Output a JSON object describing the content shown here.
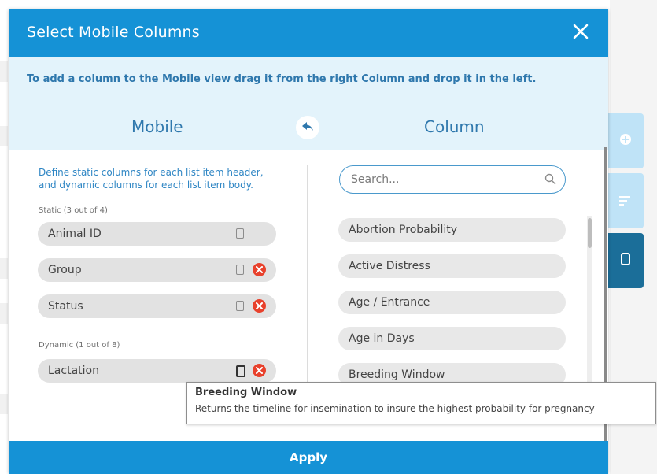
{
  "modal": {
    "title": "Select Mobile Columns",
    "instruction": "To add a column to the Mobile view drag it from the right Column and drop it in the left.",
    "mobile_heading": "Mobile",
    "column_heading": "Column",
    "apply_label": "Apply"
  },
  "mobile_panel": {
    "hint": "Define static columns for each list item header, and dynamic columns for each list item body.",
    "static_label": "Static (3 out of 4)",
    "static_items": [
      {
        "label": "Animal ID",
        "removable": false
      },
      {
        "label": "Group",
        "removable": true
      },
      {
        "label": "Status",
        "removable": true
      }
    ],
    "dynamic_label": "Dynamic (1 out of 8)",
    "dynamic_items": [
      {
        "label": "Lactation",
        "removable": true
      }
    ]
  },
  "column_panel": {
    "search_placeholder": "Search...",
    "items": [
      {
        "label": "Abortion Probability"
      },
      {
        "label": "Active Distress"
      },
      {
        "label": "Age / Entrance"
      },
      {
        "label": "Age in Days"
      },
      {
        "label": "Breeding Window"
      }
    ]
  },
  "tooltip": {
    "title": "Breeding Window",
    "body": "Returns the timeline for  insemination to insure the highest probability for pregnancy"
  },
  "side_tabs": [
    {
      "icon": "plus-circle-icon"
    },
    {
      "icon": "sort-lines-icon"
    },
    {
      "icon": "mobile-icon"
    }
  ],
  "colors": {
    "header": "#1592d6",
    "info_band": "#e3f3fb",
    "text_blue": "#2f78ad",
    "remove_red": "#e8412c",
    "tab_dark": "#1b6e99",
    "tab_light": "#bfe3f7"
  }
}
